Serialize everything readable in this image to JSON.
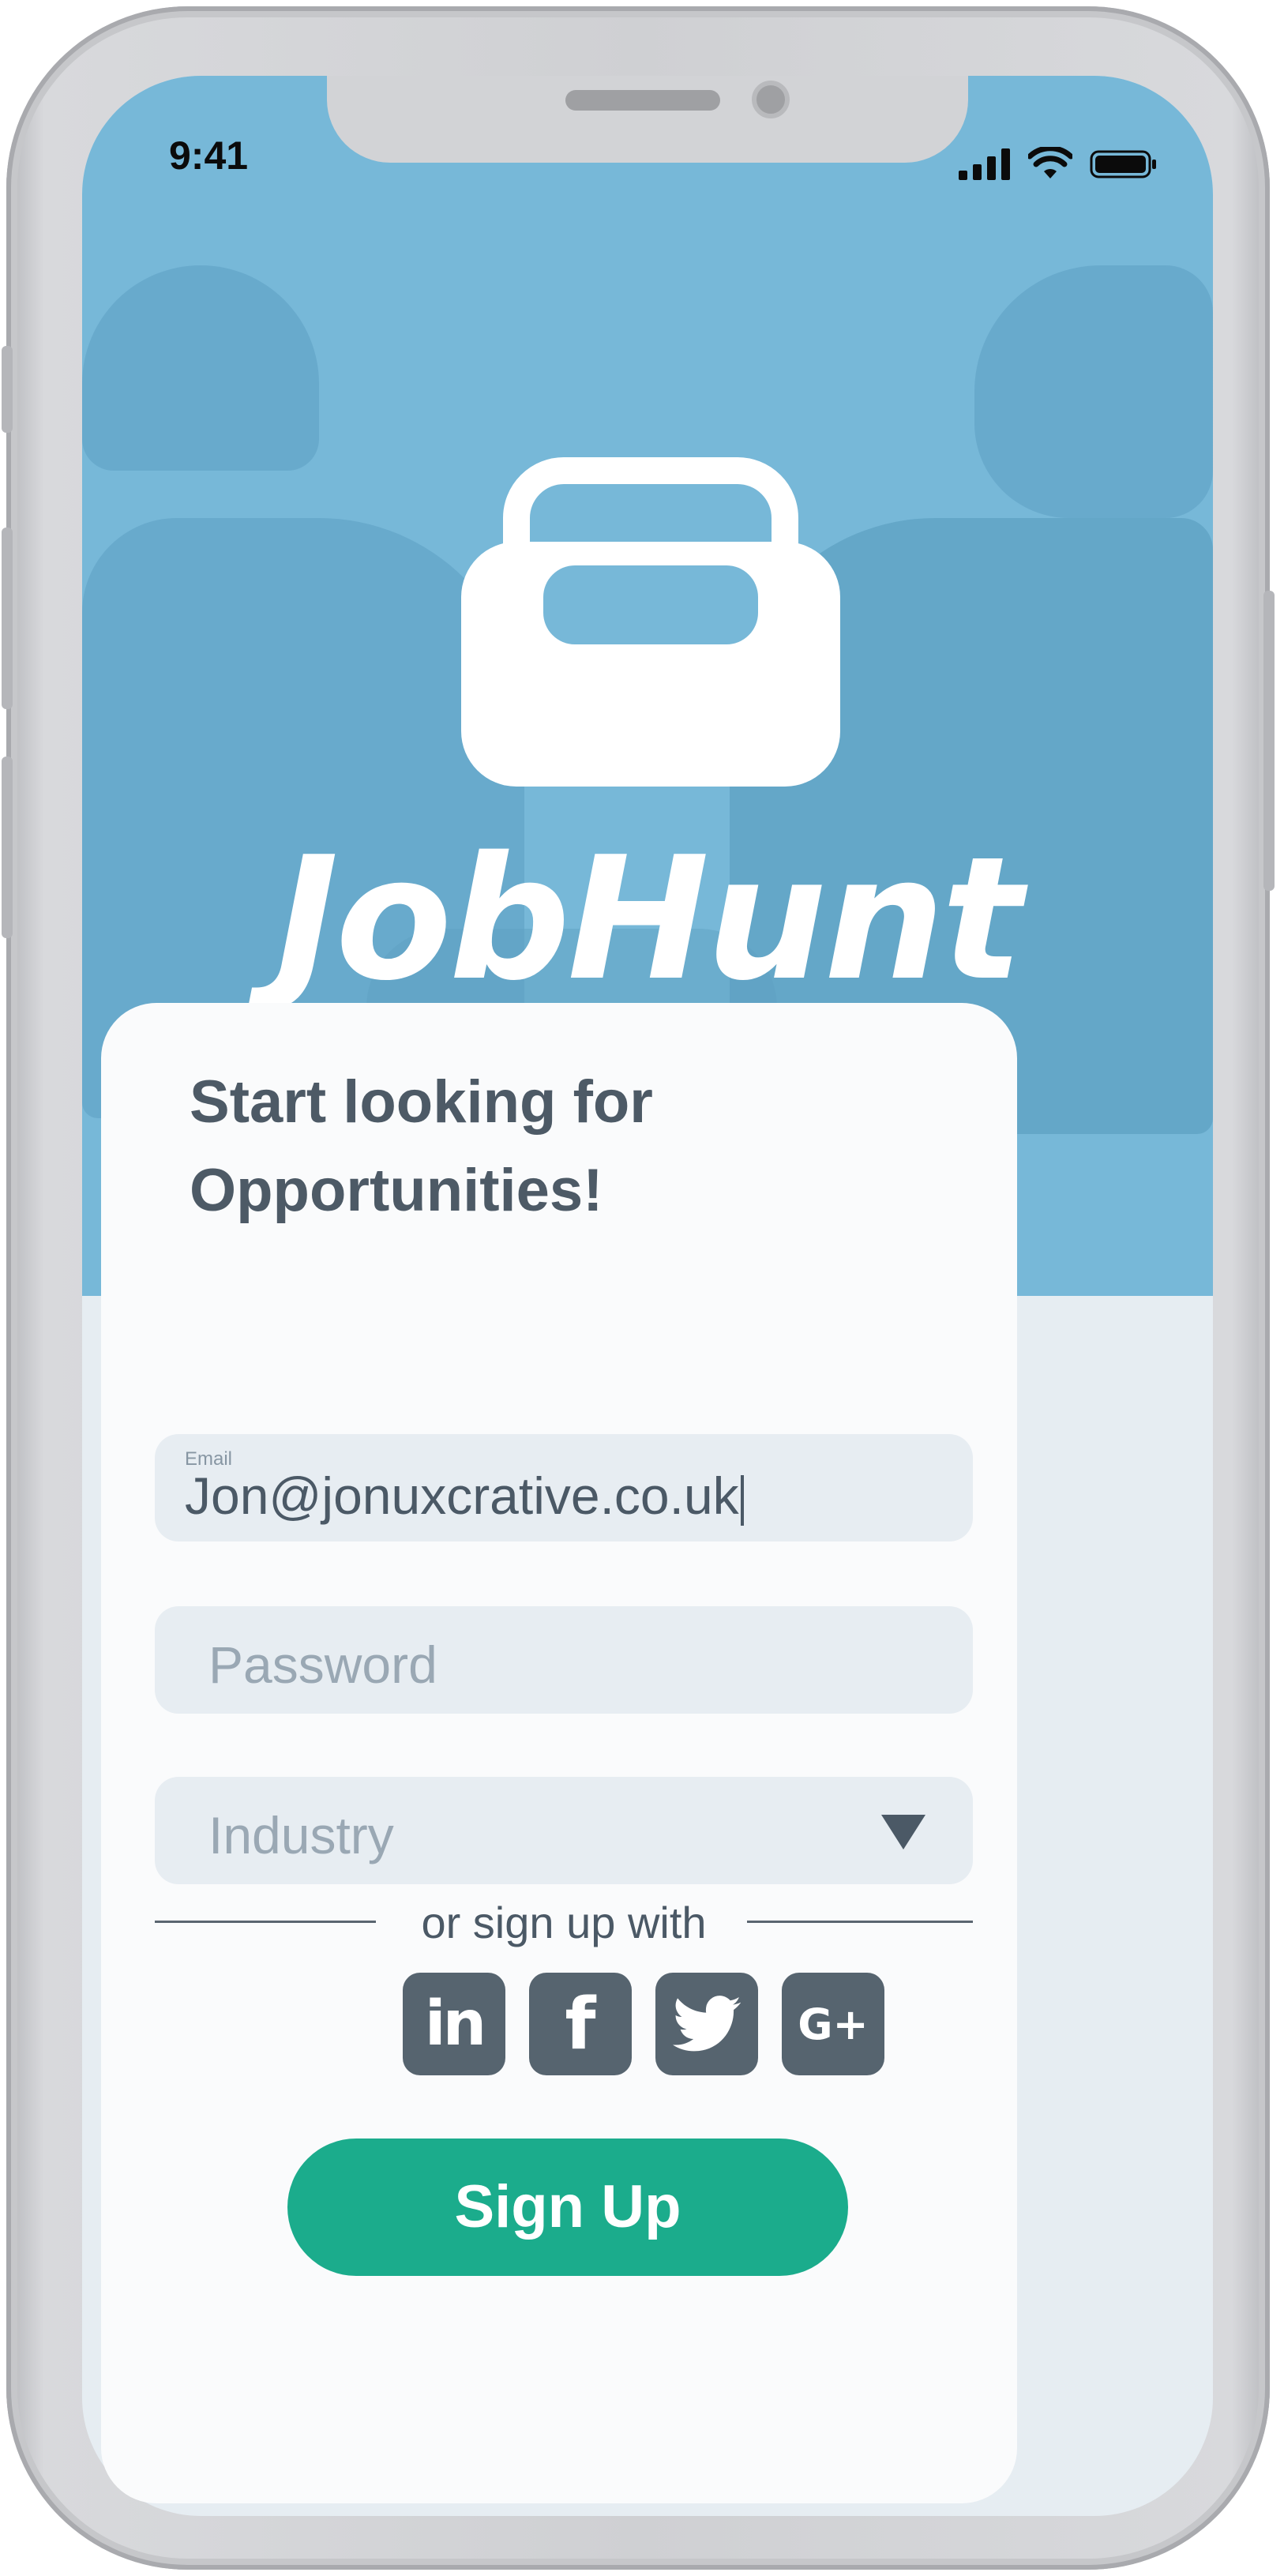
{
  "status_bar": {
    "time": "9:41"
  },
  "brand": {
    "name": "JobHunt"
  },
  "form": {
    "headline_line1": "Start looking for",
    "headline_line2": "Opportunities!",
    "email": {
      "label": "Email",
      "value": "Jon@jonuxcrative.co.uk"
    },
    "password": {
      "placeholder": "Password"
    },
    "industry": {
      "placeholder": "Industry"
    },
    "divider_text": "or sign up with",
    "social": [
      {
        "name": "linkedin-icon",
        "glyph": "in"
      },
      {
        "name": "facebook-icon",
        "glyph": "f"
      },
      {
        "name": "twitter-icon",
        "glyph": "bird"
      },
      {
        "name": "google-plus-icon",
        "glyph": "G+"
      }
    ],
    "submit_label": "Sign Up"
  },
  "colors": {
    "hero": "#77b8d8",
    "accent": "#1bac8c",
    "text": "#4d5a66",
    "field_bg": "#e7edf2",
    "social_bg": "#56646f"
  }
}
